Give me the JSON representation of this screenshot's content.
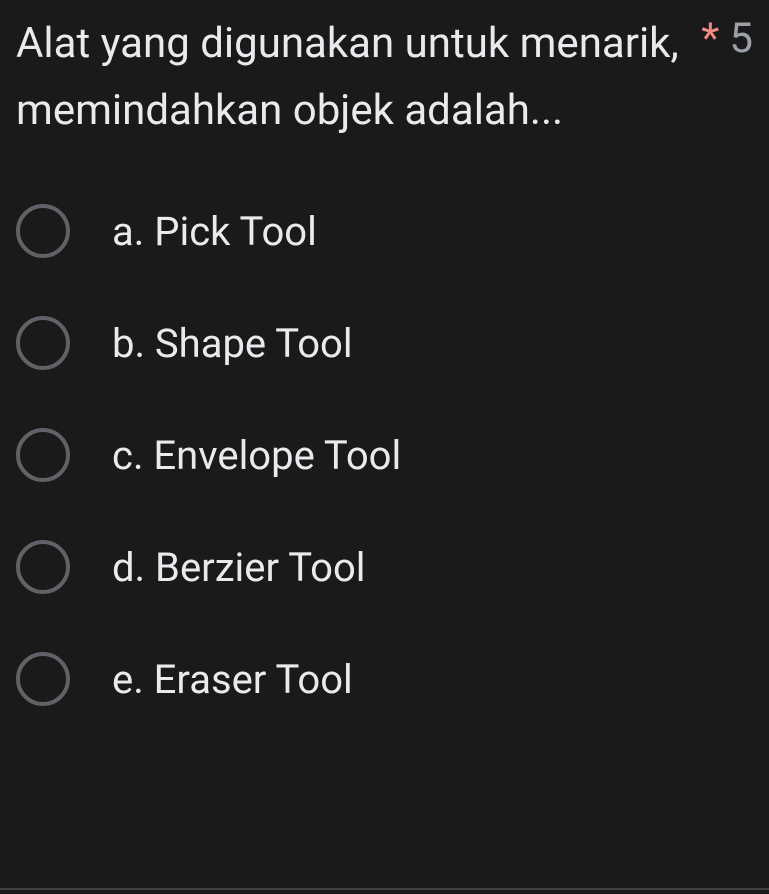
{
  "question": {
    "text": "Alat yang digunakan untuk menarik, memindahkan objek adalah...",
    "required_marker": "*",
    "points": "5"
  },
  "options": [
    {
      "label": "a. Pick Tool"
    },
    {
      "label": "b. Shape Tool"
    },
    {
      "label": "c. Envelope Tool"
    },
    {
      "label": "d. Berzier Tool"
    },
    {
      "label": "e. Eraser Tool"
    }
  ]
}
